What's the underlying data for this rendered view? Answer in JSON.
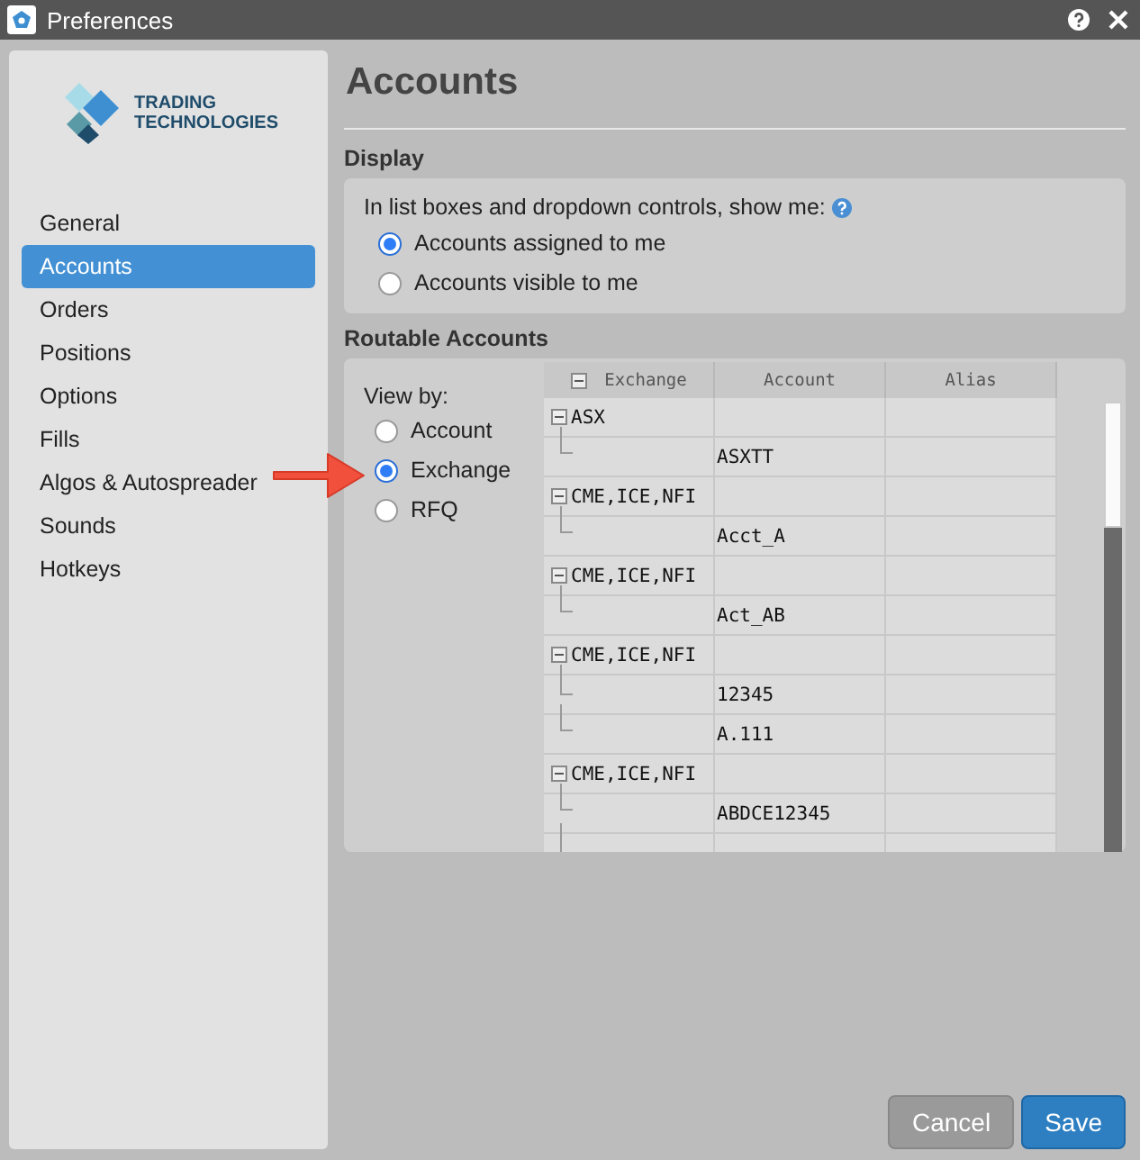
{
  "window": {
    "title": "Preferences"
  },
  "logo": {
    "lines": [
      "TRADING",
      "TECHNOLOGIES"
    ]
  },
  "sidebar": {
    "items": [
      {
        "label": "General",
        "selected": false
      },
      {
        "label": "Accounts",
        "selected": true
      },
      {
        "label": "Orders",
        "selected": false
      },
      {
        "label": "Positions",
        "selected": false
      },
      {
        "label": "Options",
        "selected": false
      },
      {
        "label": "Fills",
        "selected": false
      },
      {
        "label": "Algos & Autospreader",
        "selected": false
      },
      {
        "label": "Sounds",
        "selected": false
      },
      {
        "label": "Hotkeys",
        "selected": false
      }
    ]
  },
  "page": {
    "title": "Accounts"
  },
  "display": {
    "heading": "Display",
    "prompt": "In list boxes and dropdown controls, show me:",
    "options": [
      {
        "label": "Accounts assigned to me",
        "selected": true
      },
      {
        "label": "Accounts visible to me",
        "selected": false
      }
    ]
  },
  "routable": {
    "heading": "Routable Accounts",
    "view_by_label": "View by:",
    "view_by": [
      {
        "label": "Account",
        "selected": false
      },
      {
        "label": "Exchange",
        "selected": true
      },
      {
        "label": "RFQ",
        "selected": false
      }
    ],
    "table": {
      "columns": [
        "Exchange",
        "Account",
        "Alias"
      ],
      "header_expanded": true,
      "groups": [
        {
          "exchange": "ASX",
          "expanded": true,
          "accounts": [
            "ASXTT"
          ]
        },
        {
          "exchange": "CME,ICE,NFI",
          "expanded": true,
          "accounts": [
            "Acct_A"
          ]
        },
        {
          "exchange": "CME,ICE,NFI",
          "expanded": true,
          "accounts": [
            "Act_AB"
          ]
        },
        {
          "exchange": "CME,ICE,NFI",
          "expanded": true,
          "accounts": [
            "12345",
            "A.111"
          ]
        },
        {
          "exchange": "CME,ICE,NFI",
          "expanded": true,
          "accounts": [
            "ABDCE12345"
          ]
        }
      ]
    }
  },
  "buttons": [
    {
      "label": "Cancel",
      "kind": "secondary"
    },
    {
      "label": "Save",
      "kind": "primary"
    }
  ]
}
